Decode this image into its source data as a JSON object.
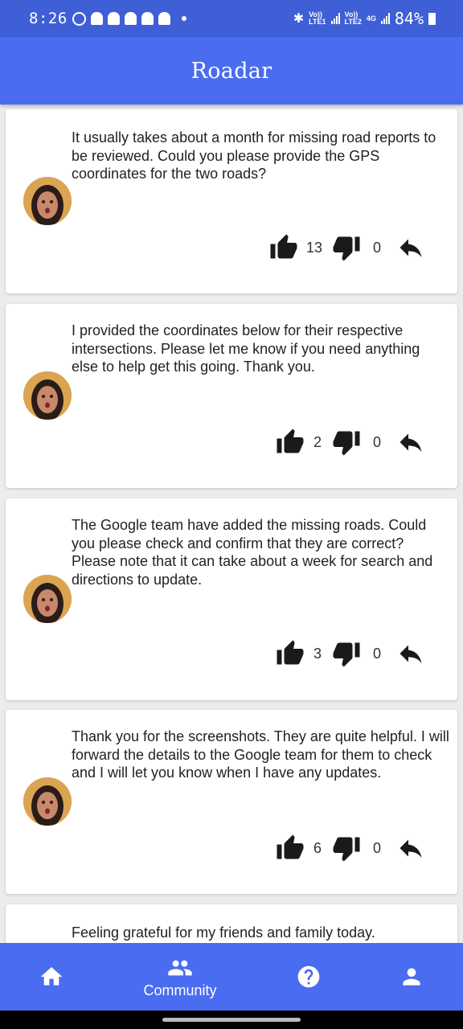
{
  "status_bar": {
    "time": "8:26",
    "net1_top": "Vo))",
    "net1_bottom": "LTE1",
    "net2_top": "Vo))",
    "net2_bottom": "LTE2",
    "net_type": "4G",
    "battery": "84%"
  },
  "app_bar": {
    "title": "Roadar"
  },
  "posts": [
    {
      "text": "It usually takes about a month for missing road reports to be reviewed. Could you please provide the GPS coordinates for the two roads?",
      "likes": "13",
      "dislikes": "0"
    },
    {
      "text": "I provided the coordinates below for their respective intersections. Please let me know if you need anything else to help get this going. Thank you.",
      "likes": "2",
      "dislikes": "0"
    },
    {
      "text": "The Google team have added the missing roads. Could you please check and confirm that they are correct? Please note that it can take about a week for search and directions to update.",
      "likes": "3",
      "dislikes": "0"
    },
    {
      "text": "Thank you for the screenshots. They are quite helpful. I will forward the details to the Google team for them to check and I will let you know when I have any updates.",
      "likes": "6",
      "dislikes": "0"
    },
    {
      "text": "Feeling grateful for my friends and family today."
    }
  ],
  "bottom_nav": {
    "items": [
      {
        "icon": "home-icon"
      },
      {
        "icon": "group-icon",
        "label": "Community"
      },
      {
        "icon": "help-icon"
      },
      {
        "icon": "profile-icon"
      }
    ]
  },
  "colors": {
    "primary": "#4a6cf0",
    "status_bar": "#3f5fd6",
    "card": "#ffffff",
    "background": "#ececec"
  }
}
